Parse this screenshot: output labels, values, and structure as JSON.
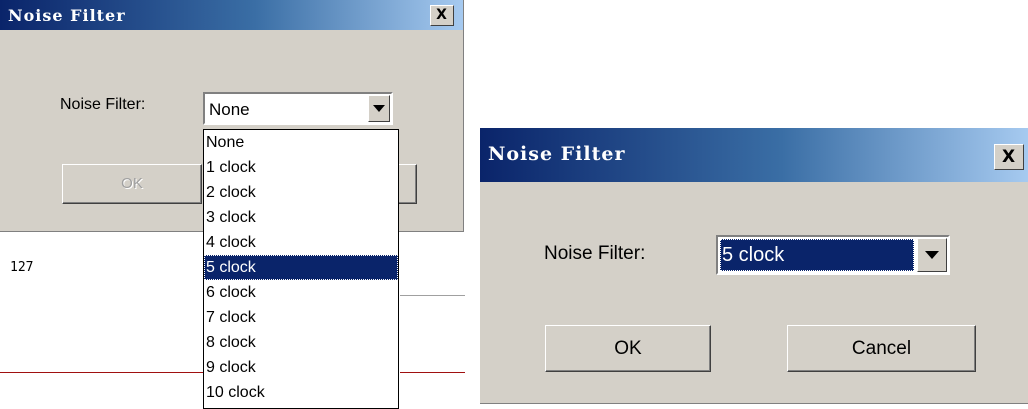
{
  "left_dialog": {
    "title": "Noise Filter",
    "close_label": "X",
    "field_label": "Noise Filter:",
    "selected_value": "None",
    "ok_label": "OK",
    "options": [
      "None",
      "1 clock",
      "2 clock",
      "3 clock",
      "4 clock",
      "5 clock",
      "6 clock",
      "7 clock",
      "8 clock",
      "9 clock",
      "10 clock"
    ],
    "highlighted_option": "5 clock"
  },
  "background": {
    "axis_value": "127",
    "colors": {
      "grey_line": "#a0a0a0",
      "red_line": "#a01010"
    }
  },
  "right_dialog": {
    "title": "Noise Filter",
    "close_label": "X",
    "field_label": "Noise Filter:",
    "selected_value": "5 clock",
    "ok_label": "OK",
    "cancel_label": "Cancel"
  },
  "colors": {
    "titlebar_start": "#0a246a",
    "titlebar_end": "#a6caf0",
    "dialog_bg": "#d4d0c8",
    "selection": "#0a246a"
  }
}
